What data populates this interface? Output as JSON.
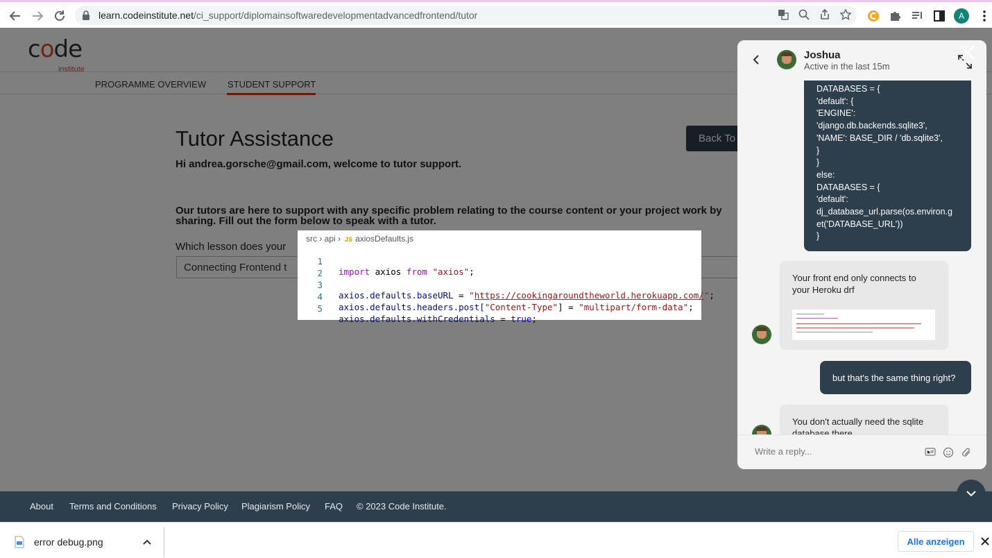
{
  "browser": {
    "url_host": "learn.codeinstitute.net",
    "url_path": "/ci_support/diplomainsoftwaredevelopmentadvancedfrontend/tutor",
    "profile_initial": "A"
  },
  "site": {
    "logo_word_prefix": "c",
    "logo_word_o": "o",
    "logo_word_suffix": "de",
    "logo_sub": "institute",
    "nav": [
      "PROGRAMME OVERVIEW",
      "STUDENT SUPPORT"
    ]
  },
  "main": {
    "title": "Tutor Assistance",
    "back_button": "Back To",
    "welcome": "Hi andrea.gorsche@gmail.com, welcome to tutor support.",
    "intro": "Our tutors are here to support with any specific problem relating to the course content or your project work by sharing. Fill out the form below to speak with a tutor.",
    "lesson_label": "Which lesson does your",
    "lesson_value": "Connecting Frontend t"
  },
  "code_preview": {
    "crumbs": [
      "src",
      "api",
      "axiosDefaults.js"
    ],
    "js_badge": "JS",
    "line_numbers": [
      "1",
      "2",
      "3",
      "4",
      "5"
    ],
    "line1": {
      "kw1": "import",
      "id": " axios ",
      "kw2": "from",
      "str": " \"axios\"",
      "end": ";"
    },
    "line3": {
      "lhs": "axios.defaults.baseURL",
      "eq": " = ",
      "q1": "\"",
      "url": "https://cookingaroundtheworld.herokuapp.com/",
      "q2": "\"",
      "end": ";"
    },
    "line4": {
      "lhs": "axios.defaults.headers.post[",
      "key": "\"Content-Type\"",
      "mid": "] = ",
      "val": "\"multipart/form-data\"",
      "end": ";"
    },
    "line5": {
      "lhs": "axios.defaults.withCredentials",
      "eq": " = ",
      "val": "true",
      "end": ";"
    }
  },
  "footer": {
    "links": [
      "About",
      "Terms and Conditions",
      "Privacy Policy",
      "Plagiarism Policy",
      "FAQ"
    ],
    "copyright": "© 2023 Code Institute."
  },
  "download_bar": {
    "file_name": "error debug.png",
    "show_all": "Alle anzeigen"
  },
  "chat": {
    "agent_name": "Joshua",
    "agent_status": "Active in the last 15m",
    "user_code_lines": [
      "DATABASES = {",
      "'default': {",
      "'ENGINE':",
      "'django.db.backends.sqlite3',",
      "'NAME': BASE_DIR / 'db.sqlite3',",
      "}",
      "}",
      "else:",
      "DATABASES = {",
      "'default':",
      "dj_database_url.parse(os.environ.g",
      "et('DATABASE_URL'))",
      "}"
    ],
    "agent_msg_1": "Your front end only connects to your Heroku drf",
    "user_msg_2": "but that's the same thing right?",
    "agent_msg_2": "You don't actually need the sqlite database there",
    "reply_placeholder": "Write a reply..."
  },
  "colors": {
    "accent": "#e04b21",
    "navy": "#2d3e4d",
    "link_blue": "#1a73e8"
  }
}
